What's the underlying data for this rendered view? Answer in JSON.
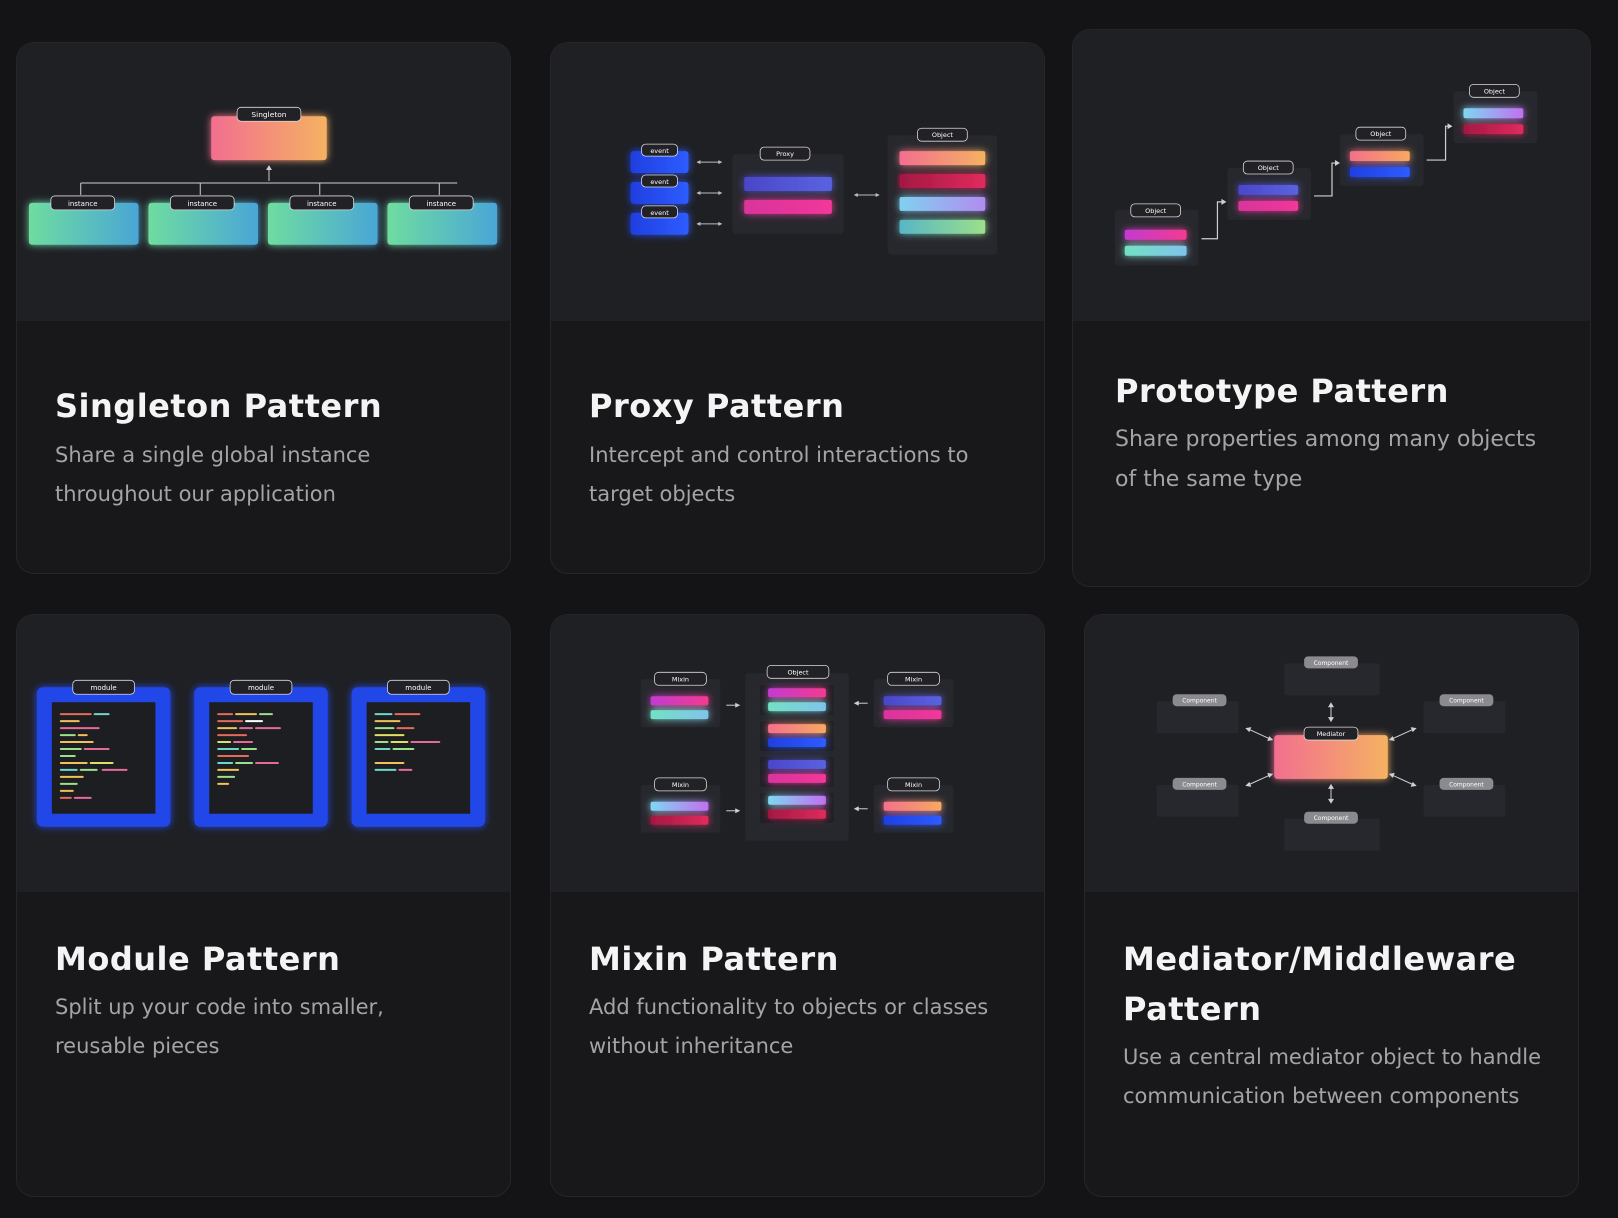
{
  "cards": [
    {
      "title": "Singleton Pattern",
      "description": "Share a single global instance throughout our application",
      "diagram": {
        "root": "Singleton",
        "children": [
          "instance",
          "instance",
          "instance",
          "instance"
        ]
      }
    },
    {
      "title": "Proxy Pattern",
      "description": "Intercept and control interactions to target objects",
      "diagram": {
        "events": [
          "event",
          "event",
          "event"
        ],
        "proxy": "Proxy",
        "object": "Object"
      }
    },
    {
      "title": "Prototype Pattern",
      "description": "Share properties among many objects of the same type",
      "diagram": {
        "objects": [
          "Object",
          "Object",
          "Object",
          "Object"
        ]
      }
    },
    {
      "title": "Module Pattern",
      "description": "Split up your code into smaller, reusable pieces",
      "diagram": {
        "modules": [
          "module",
          "module",
          "module"
        ]
      }
    },
    {
      "title": "Mixin Pattern",
      "description": "Add functionality to objects or classes without inheritance",
      "diagram": {
        "object": "Object",
        "mixins": [
          "Mixin",
          "Mixin",
          "Mixin",
          "Mixin"
        ]
      }
    },
    {
      "title": "Mediator/Middleware Pattern",
      "description": "Use a central mediator object to handle communication between components",
      "diagram": {
        "mediator": "Mediator",
        "components": [
          "Component",
          "Component",
          "Component",
          "Component",
          "Component",
          "Component"
        ]
      }
    }
  ],
  "colors": {
    "background": "#141416",
    "card": "#18181a",
    "illustration": "#1f2024",
    "title": "#f4f4f5",
    "description": "#a3a3a8",
    "module_blue": "#2346e8"
  }
}
